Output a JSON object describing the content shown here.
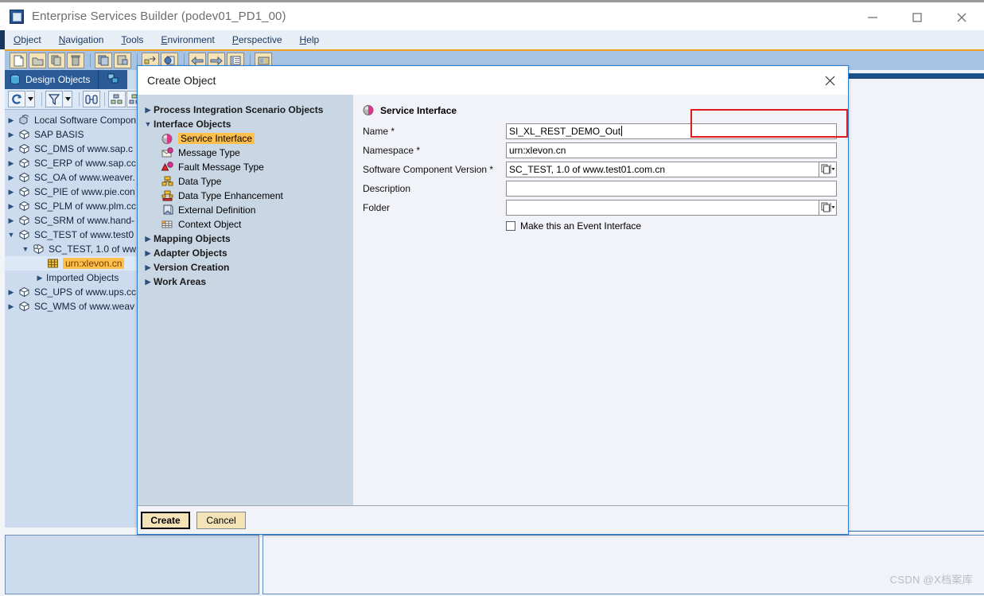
{
  "window": {
    "title": "Enterprise Services Builder (podev01_PD1_00)",
    "app_icon": "sap-cube-icon",
    "controls": {
      "minimize": "minimize-icon",
      "maximize": "maximize-icon",
      "close": "close-icon"
    }
  },
  "menubar": {
    "items": [
      {
        "label": "Object",
        "mnemonic": "O"
      },
      {
        "label": "Navigation",
        "mnemonic": "N"
      },
      {
        "label": "Tools",
        "mnemonic": "T"
      },
      {
        "label": "Environment",
        "mnemonic": "E"
      },
      {
        "label": "Perspective",
        "mnemonic": "P"
      },
      {
        "label": "Help",
        "mnemonic": "H"
      }
    ]
  },
  "toolbar": {
    "buttons": [
      {
        "name": "new-icon"
      },
      {
        "name": "open-folder-icon"
      },
      {
        "name": "copy-icon"
      },
      {
        "name": "delete-trash-icon"
      },
      {
        "name": "save-all-icon"
      },
      {
        "name": "check-objects-icon"
      },
      {
        "name": "activate-icon"
      },
      {
        "name": "where-used-icon"
      },
      {
        "name": "back-arrow-icon"
      },
      {
        "name": "forward-arrow-icon"
      },
      {
        "name": "list-view-icon"
      },
      {
        "name": "settings-icon"
      }
    ]
  },
  "workspace": {
    "tabs": [
      {
        "label": "Design Objects",
        "icon": "design-objects-icon",
        "active": true
      },
      {
        "label": "",
        "icon": "configuration-objects-icon",
        "active": false
      }
    ],
    "tree_toolbar": [
      {
        "name": "refresh-icon",
        "caret": true
      },
      {
        "name": "filter-icon",
        "caret": true
      },
      {
        "name": "find-icon",
        "caret": false
      },
      {
        "name": "sort-descending-icon",
        "caret": false
      },
      {
        "name": "sort-ascending-icon",
        "caret": false
      },
      {
        "name": "collapse-icon",
        "caret": false
      }
    ],
    "tree": [
      {
        "label": "Local Software Compon",
        "icon": "local-software-icon",
        "indent": 0,
        "arrow": "collapsed",
        "selected": false,
        "highlight": false
      },
      {
        "label": "SAP BASIS",
        "icon": "swcv-icon",
        "indent": 0,
        "arrow": "collapsed",
        "selected": false,
        "highlight": false
      },
      {
        "label": "SC_DMS of www.sap.c",
        "icon": "swcv-icon",
        "indent": 0,
        "arrow": "collapsed",
        "selected": false,
        "highlight": false
      },
      {
        "label": "SC_ERP of www.sap.cc",
        "icon": "swcv-icon",
        "indent": 0,
        "arrow": "collapsed",
        "selected": false,
        "highlight": false
      },
      {
        "label": "SC_OA of www.weaver.",
        "icon": "swcv-icon",
        "indent": 0,
        "arrow": "collapsed",
        "selected": false,
        "highlight": false
      },
      {
        "label": "SC_PIE of www.pie.con",
        "icon": "swcv-icon",
        "indent": 0,
        "arrow": "collapsed",
        "selected": false,
        "highlight": false
      },
      {
        "label": "SC_PLM of www.plm.cc",
        "icon": "swcv-icon",
        "indent": 0,
        "arrow": "collapsed",
        "selected": false,
        "highlight": false
      },
      {
        "label": "SC_SRM of www.hand-",
        "icon": "swcv-icon",
        "indent": 0,
        "arrow": "collapsed",
        "selected": false,
        "highlight": false
      },
      {
        "label": "SC_TEST of www.test0",
        "icon": "swcv-icon",
        "indent": 0,
        "arrow": "expanded",
        "selected": false,
        "highlight": false
      },
      {
        "label": "SC_TEST, 1.0 of ww",
        "icon": "swcv-version-icon",
        "indent": 1,
        "arrow": "expanded",
        "selected": false,
        "highlight": false
      },
      {
        "label": "urn:xlevon.cn",
        "icon": "namespace-icon",
        "indent": 2,
        "arrow": "none",
        "selected": true,
        "highlight": true
      },
      {
        "label": "Imported Objects",
        "icon": "none",
        "indent": 2,
        "arrow": "collapsed",
        "selected": false,
        "highlight": false
      },
      {
        "label": "SC_UPS of www.ups.cc",
        "icon": "swcv-icon",
        "indent": 0,
        "arrow": "collapsed",
        "selected": false,
        "highlight": false
      },
      {
        "label": "SC_WMS of www.weav",
        "icon": "swcv-icon",
        "indent": 0,
        "arrow": "collapsed",
        "selected": false,
        "highlight": false
      }
    ]
  },
  "dialog": {
    "title": "Create Object",
    "close_icon": "close-icon",
    "tree": [
      {
        "label": "Process Integration Scenario Objects",
        "group": true,
        "arrow": "collapsed",
        "icon": "none",
        "selected": false
      },
      {
        "label": "Interface Objects",
        "group": true,
        "arrow": "expanded",
        "icon": "none",
        "selected": false
      },
      {
        "label": "Service Interface",
        "group": false,
        "arrow": "none",
        "icon": "service-interface-icon",
        "selected": true
      },
      {
        "label": "Message Type",
        "group": false,
        "arrow": "none",
        "icon": "message-type-icon",
        "selected": false
      },
      {
        "label": "Fault Message Type",
        "group": false,
        "arrow": "none",
        "icon": "fault-message-type-icon",
        "selected": false
      },
      {
        "label": "Data Type",
        "group": false,
        "arrow": "none",
        "icon": "data-type-icon",
        "selected": false
      },
      {
        "label": "Data Type Enhancement",
        "group": false,
        "arrow": "none",
        "icon": "data-type-enhancement-icon",
        "selected": false
      },
      {
        "label": "External Definition",
        "group": false,
        "arrow": "none",
        "icon": "external-definition-icon",
        "selected": false
      },
      {
        "label": "Context Object",
        "group": false,
        "arrow": "none",
        "icon": "context-object-icon",
        "selected": false
      },
      {
        "label": "Mapping Objects",
        "group": true,
        "arrow": "collapsed",
        "icon": "none",
        "selected": false
      },
      {
        "label": "Adapter Objects",
        "group": true,
        "arrow": "collapsed",
        "icon": "none",
        "selected": false
      },
      {
        "label": "Version Creation",
        "group": true,
        "arrow": "collapsed",
        "icon": "none",
        "selected": false
      },
      {
        "label": "Work Areas",
        "group": true,
        "arrow": "collapsed",
        "icon": "none",
        "selected": false
      }
    ],
    "form": {
      "header": "Service Interface",
      "header_icon": "service-interface-icon",
      "fields": [
        {
          "label": "Name",
          "required": true,
          "value": "SI_XL_REST_DEMO_Out",
          "help": false,
          "focused": true
        },
        {
          "label": "Namespace",
          "required": true,
          "value": "urn:xlevon.cn",
          "help": false,
          "focused": false
        },
        {
          "label": "Software Component Version",
          "required": true,
          "value": "SC_TEST, 1.0 of www.test01.com.cn",
          "help": true,
          "focused": false
        },
        {
          "label": "Description",
          "required": false,
          "value": "",
          "help": false,
          "focused": false
        },
        {
          "label": "Folder",
          "required": false,
          "value": "",
          "help": true,
          "focused": false
        }
      ],
      "checkbox": {
        "label": "Make this an Event Interface",
        "checked": false
      },
      "highlight_color": "#e01b1b"
    },
    "buttons": [
      {
        "label": "Create",
        "default": true
      },
      {
        "label": "Cancel",
        "default": false
      }
    ]
  },
  "watermark": "CSDN @X档案库"
}
